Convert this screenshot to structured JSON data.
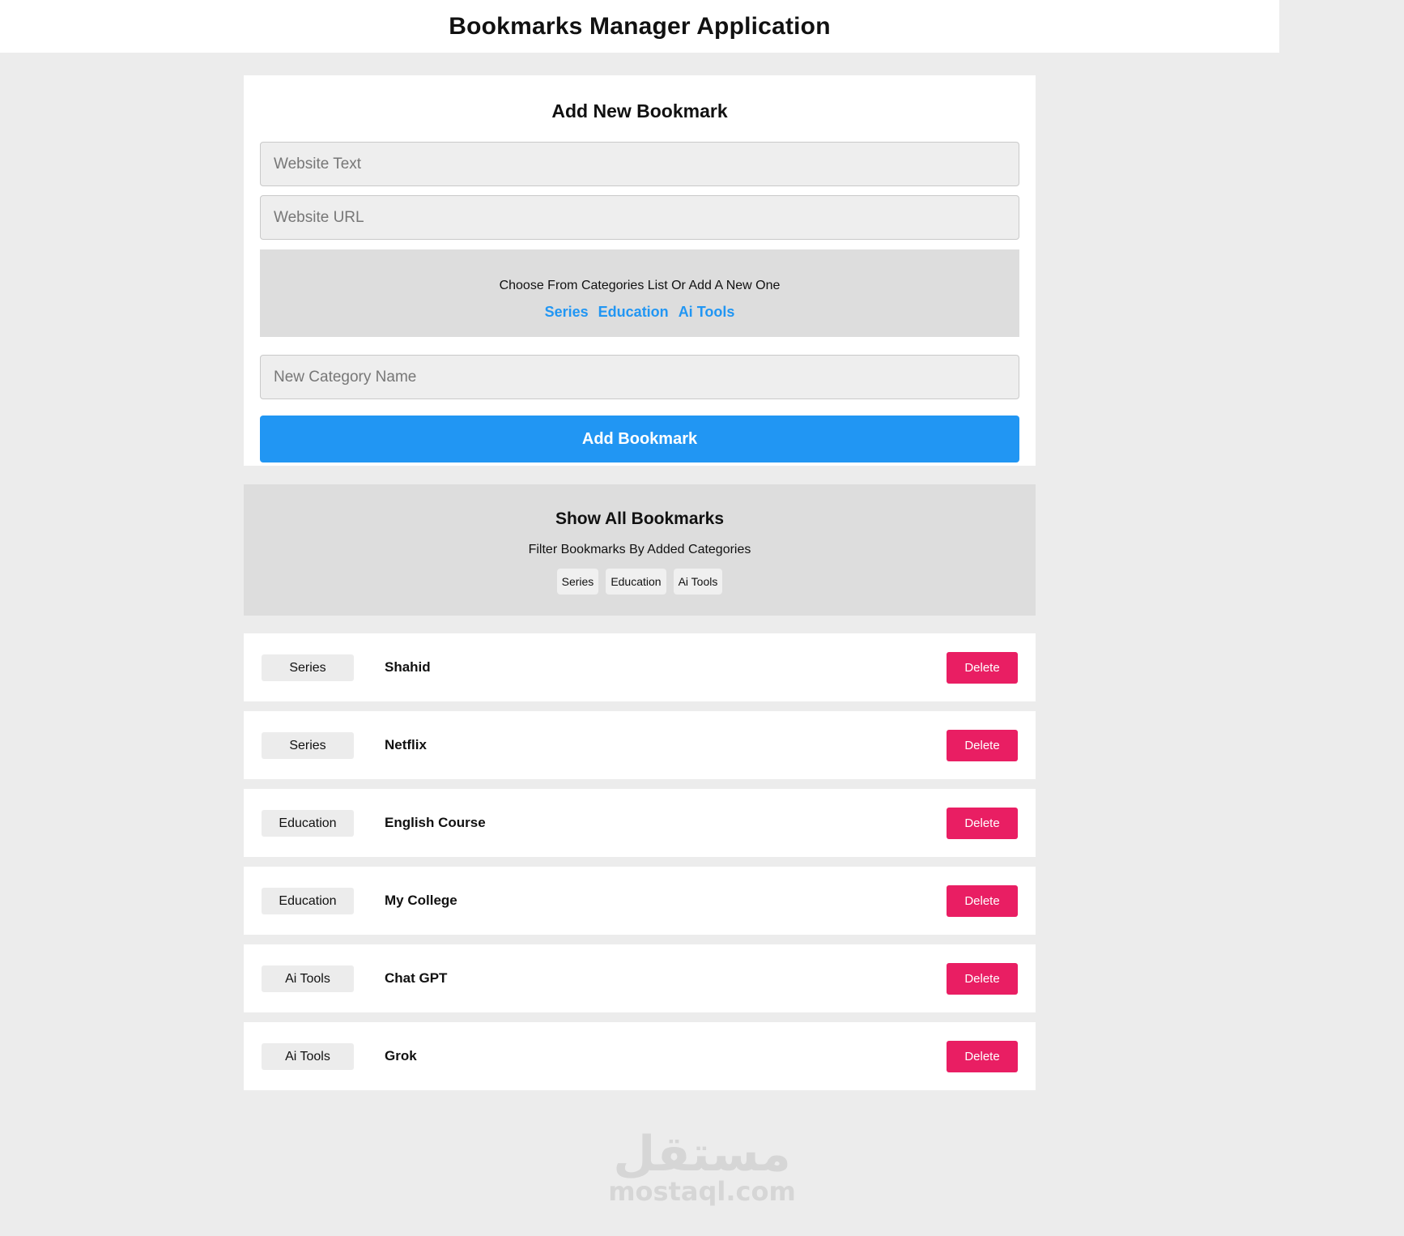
{
  "app": {
    "title": "Bookmarks Manager Application"
  },
  "add_form": {
    "title": "Add New Bookmark",
    "website_text_placeholder": "Website Text",
    "website_url_placeholder": "Website URL",
    "categories_prompt": "Choose From Categories List Or Add A New One",
    "categories": [
      "Series",
      "Education",
      "Ai Tools"
    ],
    "new_category_placeholder": "New Category Name",
    "submit_label": "Add Bookmark"
  },
  "show_all": {
    "title": "Show All Bookmarks",
    "filter_label": "Filter Bookmarks By Added Categories",
    "filters": [
      "Series",
      "Education",
      "Ai Tools"
    ]
  },
  "bookmarks": [
    {
      "category": "Series",
      "name": "Shahid",
      "delete_label": "Delete"
    },
    {
      "category": "Series",
      "name": "Netflix",
      "delete_label": "Delete"
    },
    {
      "category": "Education",
      "name": "English Course",
      "delete_label": "Delete"
    },
    {
      "category": "Education",
      "name": "My College",
      "delete_label": "Delete"
    },
    {
      "category": "Ai Tools",
      "name": "Chat GPT",
      "delete_label": "Delete"
    },
    {
      "category": "Ai Tools",
      "name": "Grok",
      "delete_label": "Delete"
    }
  ],
  "watermark": {
    "arabic": "مستقل",
    "latin": "mostaql.com"
  },
  "colors": {
    "primary": "#2196f3",
    "danger": "#e91e63",
    "page_background": "#ececec",
    "panel_gray": "#dddddd"
  }
}
